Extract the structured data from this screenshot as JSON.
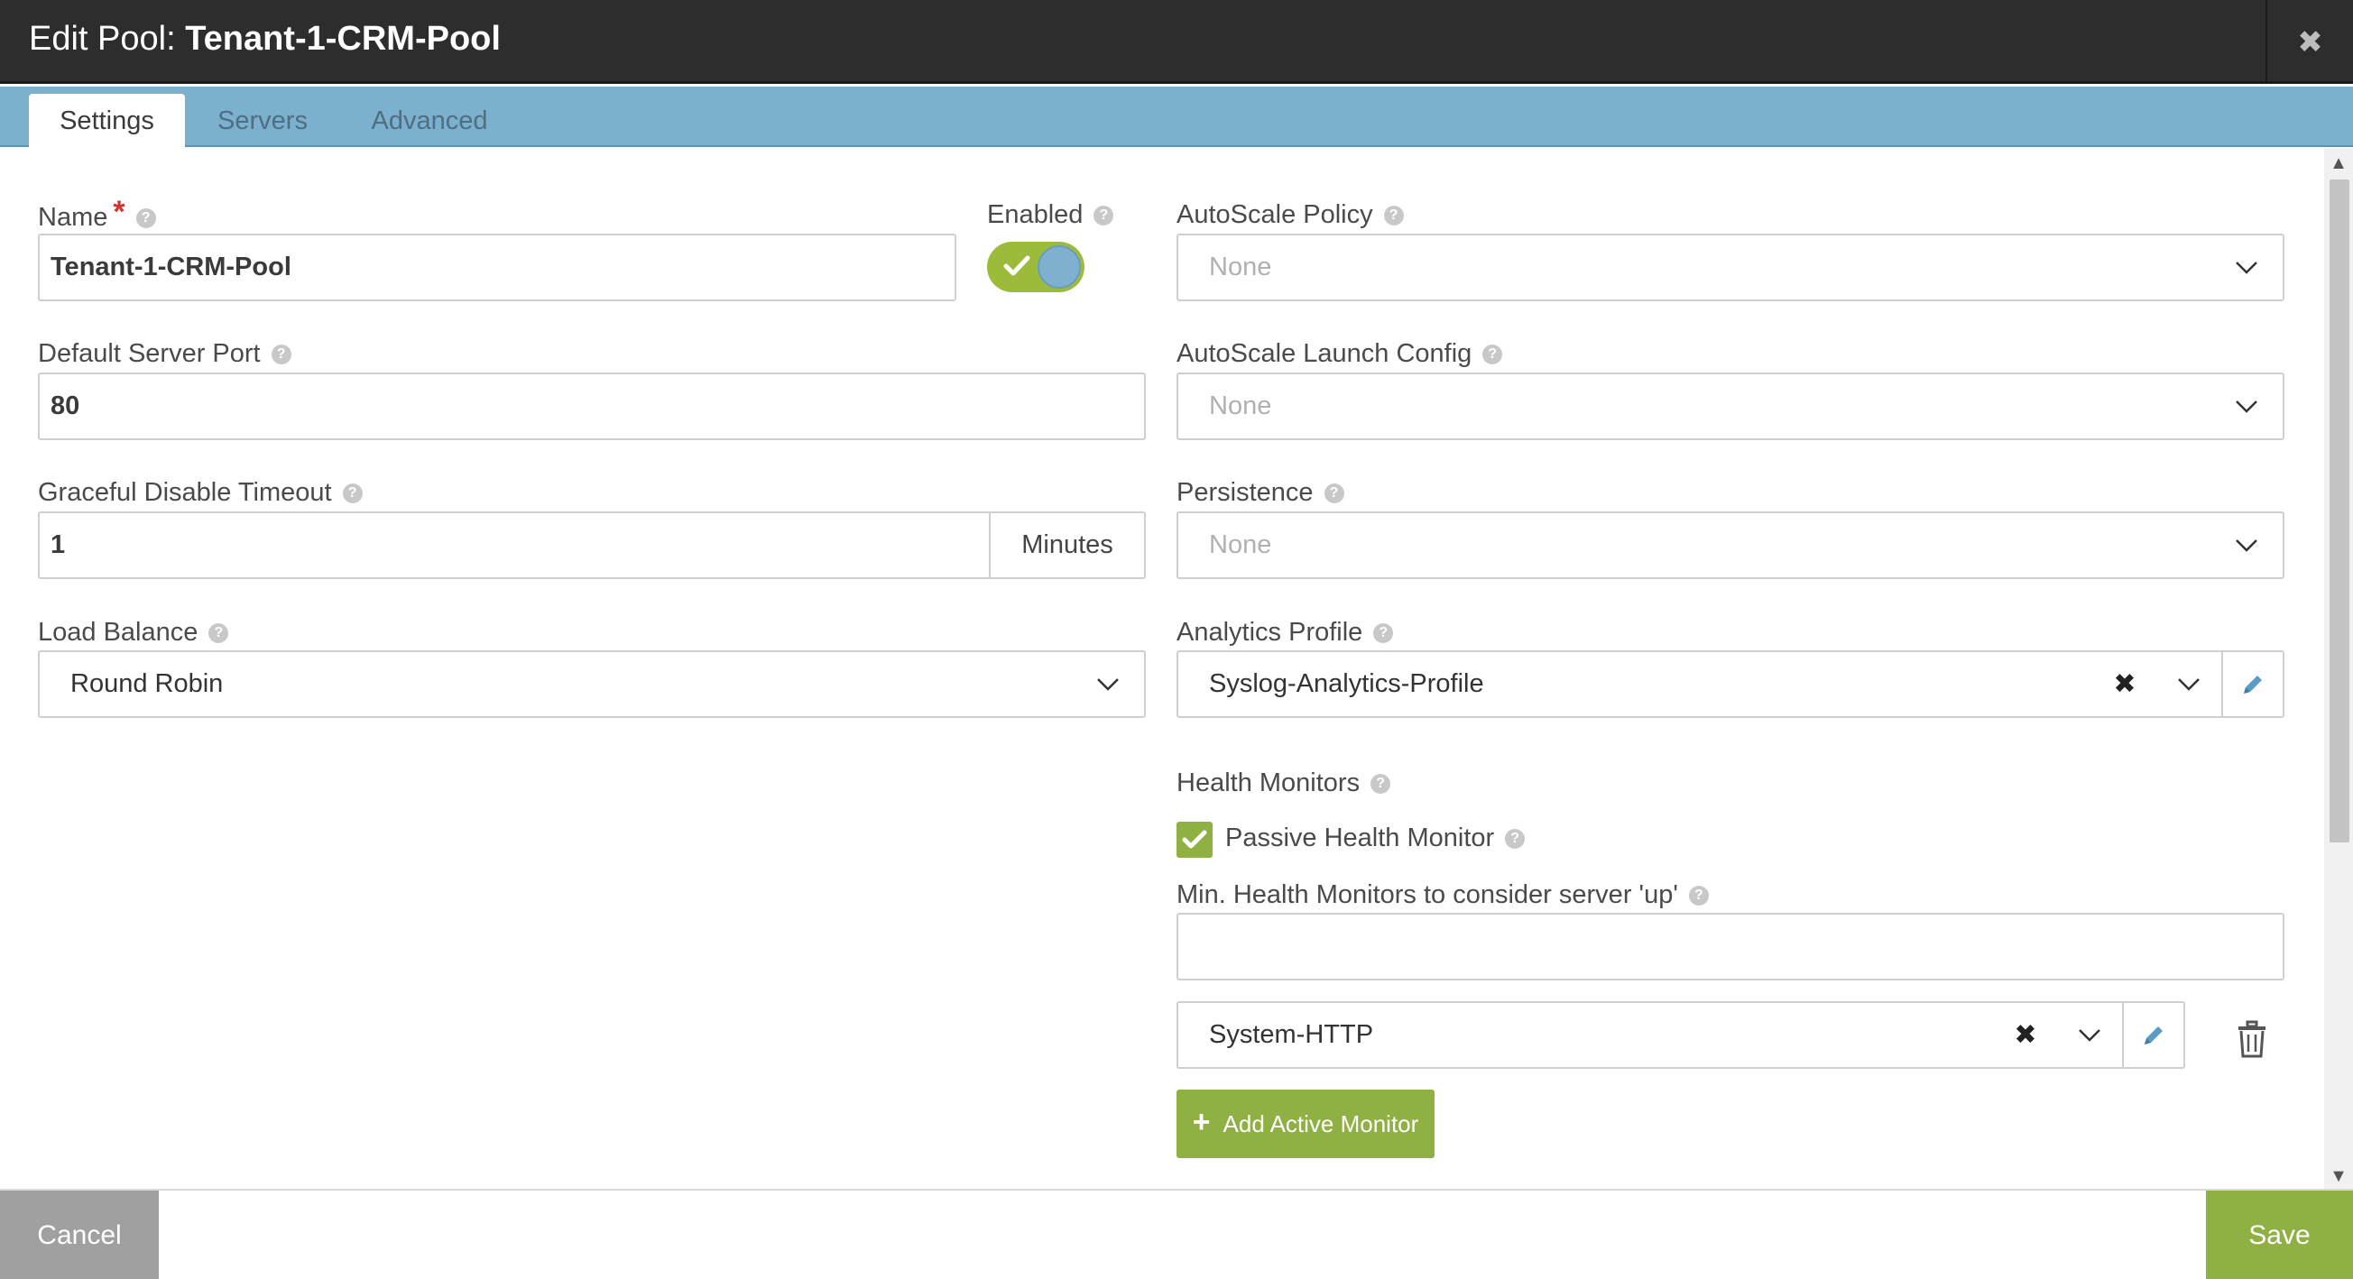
{
  "header": {
    "title_prefix": "Edit Pool: ",
    "title_name": "Tenant-1-CRM-Pool",
    "close_icon": "close-icon"
  },
  "tabs": [
    {
      "label": "Settings",
      "active": true
    },
    {
      "label": "Servers",
      "active": false
    },
    {
      "label": "Advanced",
      "active": false
    }
  ],
  "left": {
    "name": {
      "label": "Name",
      "required": "*",
      "value": "Tenant-1-CRM-Pool"
    },
    "enabled": {
      "label": "Enabled",
      "on": true
    },
    "default_port": {
      "label": "Default Server Port",
      "value": "80"
    },
    "graceful": {
      "label": "Graceful Disable Timeout",
      "value": "1",
      "unit": "Minutes"
    },
    "load_balance": {
      "label": "Load Balance",
      "value": "Round Robin"
    }
  },
  "right": {
    "autoscale_policy": {
      "label": "AutoScale Policy",
      "placeholder": "None"
    },
    "autoscale_launch": {
      "label": "AutoScale Launch Config",
      "placeholder": "None"
    },
    "persistence": {
      "label": "Persistence",
      "placeholder": "None"
    },
    "analytics": {
      "label": "Analytics Profile",
      "value": "Syslog-Analytics-Profile"
    },
    "health": {
      "label": "Health Monitors",
      "passive_label": "Passive Health Monitor",
      "passive_checked": true,
      "min_label": "Min. Health Monitors to consider server 'up'",
      "min_value": "",
      "monitor_value": "System-HTTP",
      "add_label": "Add Active Monitor"
    }
  },
  "footer": {
    "cancel": "Cancel",
    "save": "Save"
  },
  "colors": {
    "header_bg": "#2d2d2d",
    "tabbar_bg": "#7cb0cf",
    "accent_green": "#8fb043",
    "toggle_knob": "#7fb0cf",
    "cancel_bg": "#a0a0a0"
  }
}
